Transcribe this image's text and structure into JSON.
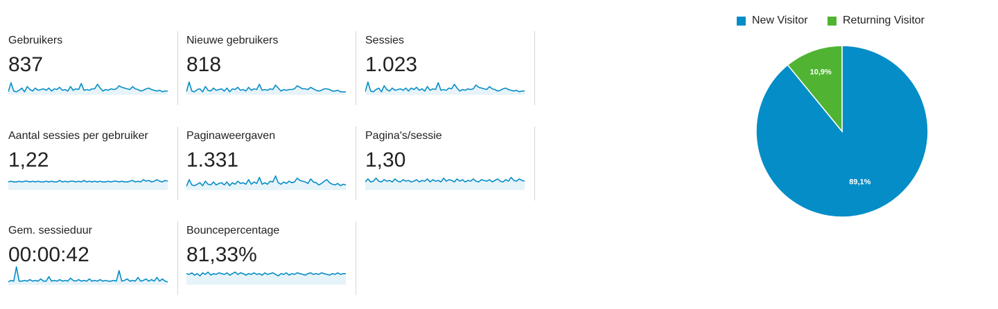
{
  "metrics": [
    {
      "label": "Gebruikers",
      "value": "837",
      "spark": [
        2,
        14,
        3,
        2,
        4,
        7,
        2,
        9,
        5,
        3,
        7,
        4,
        5,
        6,
        4,
        7,
        3,
        6,
        5,
        8,
        4,
        5,
        3,
        9,
        4,
        6,
        5,
        13,
        4,
        5,
        4,
        6,
        6,
        12,
        7,
        3,
        5,
        4,
        6,
        5,
        6,
        10,
        8,
        7,
        6,
        5,
        9,
        6,
        5,
        3,
        4,
        6,
        7,
        5,
        4,
        3,
        4,
        2,
        3,
        3
      ]
    },
    {
      "label": "Nieuwe gebruikers",
      "value": "818",
      "spark": [
        2,
        15,
        3,
        2,
        5,
        6,
        2,
        9,
        4,
        3,
        7,
        4,
        5,
        6,
        3,
        7,
        2,
        6,
        5,
        8,
        4,
        5,
        3,
        8,
        4,
        6,
        5,
        12,
        4,
        5,
        4,
        6,
        5,
        11,
        7,
        3,
        5,
        4,
        5,
        5,
        6,
        10,
        8,
        6,
        6,
        5,
        8,
        6,
        4,
        3,
        4,
        6,
        6,
        5,
        3,
        3,
        4,
        2,
        2,
        2
      ]
    },
    {
      "label": "Sessies",
      "value": "1.023",
      "spark": [
        2,
        15,
        3,
        2,
        5,
        7,
        2,
        10,
        5,
        3,
        7,
        4,
        5,
        6,
        4,
        7,
        3,
        7,
        5,
        8,
        4,
        6,
        3,
        9,
        4,
        6,
        5,
        14,
        4,
        5,
        4,
        7,
        6,
        12,
        7,
        3,
        5,
        4,
        6,
        5,
        6,
        11,
        8,
        7,
        6,
        5,
        9,
        6,
        5,
        3,
        4,
        6,
        7,
        5,
        4,
        3,
        4,
        2,
        3,
        3
      ]
    },
    {
      "label": "Aantal sessies per gebruiker",
      "value": "1,22",
      "spark": [
        9,
        10,
        9,
        9,
        10,
        9,
        10,
        10,
        9,
        10,
        9,
        10,
        9,
        9,
        10,
        9,
        10,
        9,
        9,
        11,
        9,
        10,
        9,
        10,
        10,
        9,
        10,
        9,
        11,
        9,
        10,
        9,
        10,
        9,
        10,
        9,
        9,
        10,
        9,
        10,
        10,
        9,
        10,
        9,
        9,
        10,
        11,
        9,
        10,
        9,
        12,
        10,
        11,
        9,
        10,
        12,
        10,
        9,
        11,
        10
      ]
    },
    {
      "label": "Paginaweergaven",
      "value": "1.331",
      "spark": [
        3,
        12,
        5,
        4,
        6,
        8,
        4,
        10,
        6,
        5,
        9,
        5,
        7,
        8,
        5,
        9,
        4,
        8,
        6,
        10,
        7,
        8,
        6,
        12,
        6,
        9,
        7,
        15,
        6,
        8,
        6,
        10,
        9,
        17,
        8,
        6,
        9,
        7,
        10,
        8,
        9,
        14,
        11,
        10,
        9,
        7,
        13,
        9,
        8,
        5,
        7,
        10,
        12,
        8,
        6,
        5,
        7,
        4,
        6,
        5
      ]
    },
    {
      "label": "Pagina's/sessie",
      "value": "1,30",
      "spark": [
        9,
        13,
        9,
        10,
        14,
        10,
        9,
        12,
        10,
        11,
        9,
        13,
        10,
        9,
        12,
        10,
        11,
        9,
        10,
        12,
        9,
        11,
        10,
        13,
        9,
        12,
        10,
        11,
        9,
        14,
        10,
        12,
        11,
        9,
        13,
        10,
        12,
        9,
        11,
        10,
        13,
        10,
        9,
        12,
        11,
        10,
        12,
        9,
        11,
        13,
        10,
        9,
        12,
        10,
        15,
        11,
        10,
        13,
        11,
        10
      ]
    },
    {
      "label": "Gem. sessieduur",
      "value": "00:00:42",
      "spark": [
        2,
        4,
        3,
        22,
        3,
        3,
        4,
        3,
        5,
        3,
        4,
        3,
        6,
        3,
        3,
        9,
        3,
        4,
        3,
        5,
        3,
        4,
        3,
        7,
        4,
        3,
        5,
        3,
        4,
        3,
        6,
        3,
        4,
        3,
        5,
        3,
        4,
        3,
        3,
        4,
        3,
        17,
        3,
        4,
        6,
        3,
        4,
        3,
        8,
        3,
        4,
        6,
        3,
        5,
        3,
        8,
        3,
        6,
        3,
        2
      ]
    },
    {
      "label": "Bouncepercentage",
      "value": "81,33%",
      "spark": [
        13,
        12,
        14,
        11,
        13,
        10,
        14,
        12,
        15,
        11,
        13,
        12,
        14,
        13,
        12,
        14,
        11,
        13,
        15,
        12,
        14,
        13,
        11,
        13,
        12,
        14,
        12,
        13,
        11,
        14,
        12,
        13,
        14,
        12,
        10,
        13,
        12,
        14,
        11,
        13,
        12,
        14,
        13,
        12,
        11,
        13,
        14,
        12,
        13,
        12,
        14,
        13,
        12,
        11,
        13,
        12,
        14,
        12,
        13,
        13
      ]
    }
  ],
  "chart_data": {
    "type": "pie",
    "legend_position": "top-right",
    "slices": [
      {
        "name": "New Visitor",
        "label": "89,1%",
        "value": 89.1,
        "color": "#058dc7"
      },
      {
        "name": "Returning Visitor",
        "label": "10,9%",
        "value": 10.9,
        "color": "#50b432"
      }
    ]
  },
  "colors": {
    "spark_line": "#058dc7",
    "spark_fill": "#e6f3f9"
  }
}
